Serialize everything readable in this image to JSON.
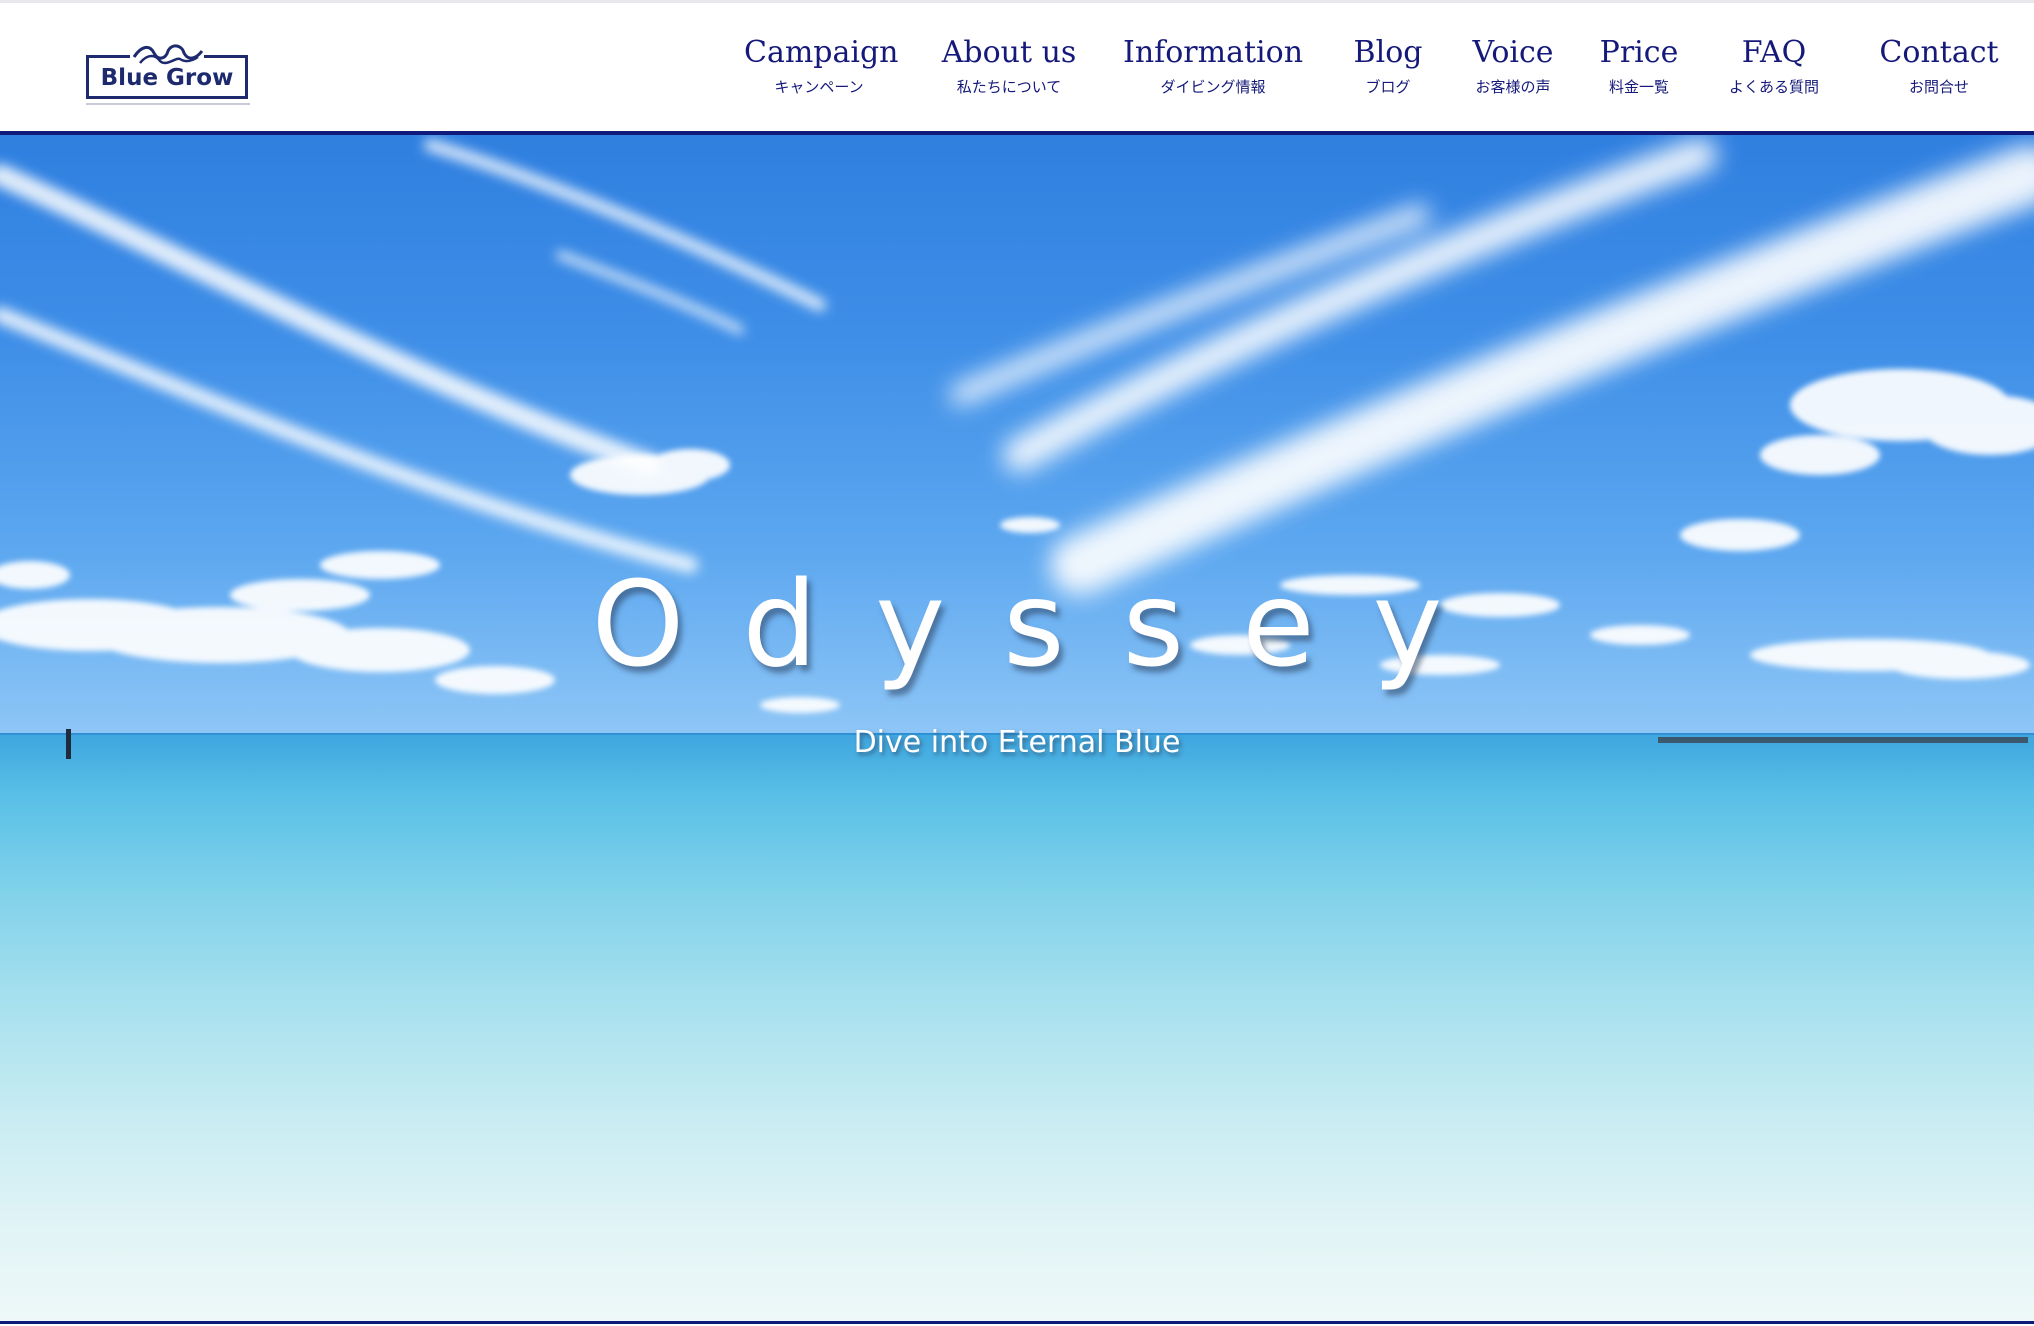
{
  "logo": {
    "text": "Blue Grow"
  },
  "nav": [
    {
      "en": "Campaign",
      "jp": "キャンペーン"
    },
    {
      "en": "About us",
      "jp": "私たちについて"
    },
    {
      "en": "Information",
      "jp": "ダイビング情報"
    },
    {
      "en": "Blog",
      "jp": "ブログ"
    },
    {
      "en": "Voice",
      "jp": "お客様の声"
    },
    {
      "en": "Price",
      "jp": "料金一覧"
    },
    {
      "en": "FAQ",
      "jp": "よくある質問"
    },
    {
      "en": "Contact",
      "jp": "お問合せ"
    }
  ],
  "hero": {
    "title": "Odyssey",
    "subtitle": "Dive into Eternal Blue"
  },
  "colors": {
    "brand_navy": "#15197a",
    "header_rule": "#0f1a7a"
  }
}
